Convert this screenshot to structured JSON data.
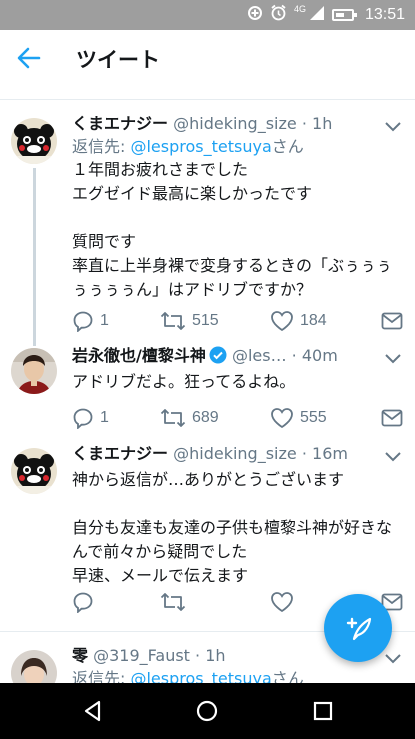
{
  "status_bar": {
    "time": "13:51",
    "network": "4G",
    "icons": [
      "data-saver-icon",
      "alarm-icon",
      "signal-icon",
      "battery-icon"
    ]
  },
  "app_bar": {
    "title": "ツイート"
  },
  "colors": {
    "accent": "#1da1f2",
    "text": "#14171a",
    "muted": "#657786",
    "divider": "#e6ecf0"
  },
  "tweets": [
    {
      "name": "くまエナジー",
      "handle": "@hideking_size",
      "dot": "·",
      "time": "1h",
      "reply_prefix": "返信先: ",
      "reply_to": "@lespros_tetsuya",
      "reply_suffix": "さん",
      "text": "１年間お疲れさまでした\nエグゼイド最高に楽しかったです\n\n質問です\n率直に上半身裸で変身するときの「ぶぅぅぅぅぅぅぅん」はアドリブですか？",
      "replies": "1",
      "retweets": "515",
      "likes": "184"
    },
    {
      "name": "岩永徹也/檀黎斗神",
      "handle": "@les…",
      "dot": "·",
      "time": "40m",
      "text": "アドリブだよ。狂ってるよね。",
      "replies": "1",
      "retweets": "689",
      "likes": "555"
    },
    {
      "name": "くまエナジー",
      "handle": "@hideking_size",
      "dot": "·",
      "time": "16m",
      "text": "神から返信が…ありがとうございます\n\n自分も友達も友達の子供も檀黎斗神が好きなんで前々から疑問でした\n早速、メールで伝えます",
      "replies": "",
      "retweets": "",
      "likes": ""
    },
    {
      "name": "零",
      "handle": "@319_Faust",
      "dot": "·",
      "time": "1h",
      "reply_prefix": "返信先: ",
      "reply_to": "@lespros_tetsuya",
      "reply_suffix": "さん"
    }
  ]
}
